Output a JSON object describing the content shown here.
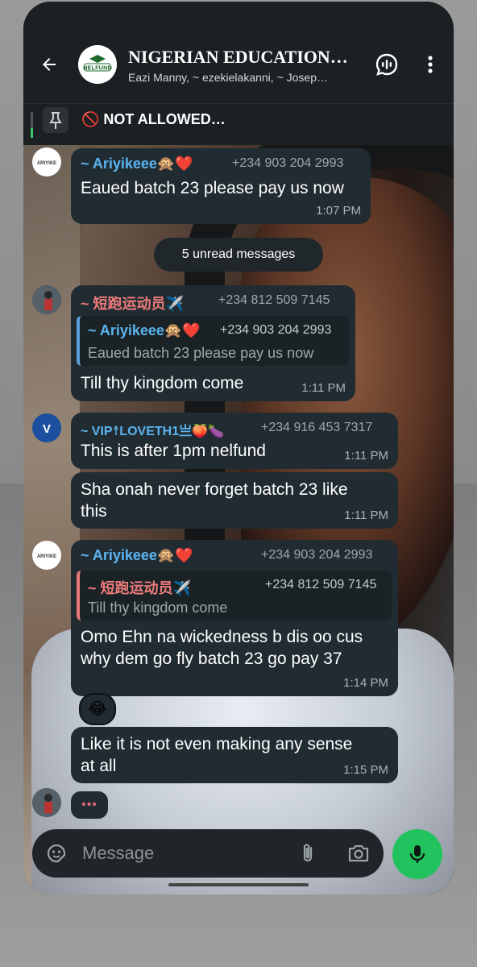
{
  "header": {
    "title": "NIGERIAN EDUCATION…",
    "subtitle": "Eazi Manny, ~ ezekielakanni, ~ Josep…",
    "group_logo_text": "NELFUND"
  },
  "pinned": {
    "text": "🚫 NOT ALLOWED…"
  },
  "unread_banner": "5 unread messages",
  "messages": [
    {
      "sender": "~ Ariyikeee🙊❤️",
      "phone": "+234 903 204 2993",
      "text": "Eaued batch 23 please pay us now",
      "time": "1:07 PM",
      "sender_color": "#5ab4f0"
    },
    {
      "sender": "~ 短跑运动员✈️",
      "phone": "+234 812 509 7145",
      "quote_sender": "~ Ariyikeee🙊❤️",
      "quote_phone": "+234 903 204 2993",
      "quote_text": "Eaued batch 23 please pay us now",
      "text": "Till thy kingdom come",
      "time": "1:11 PM",
      "sender_color": "#ec7a7a"
    },
    {
      "sender": "~ VIP☨LOVETH1亗🍑🍆",
      "phone": "+234 916 453 7317",
      "text": "This is after 1pm nelfund",
      "time": "1:11 PM",
      "sender_color": "#5ab4f0",
      "avatar_letter": "V"
    },
    {
      "text_line1": "Sha onah never forget batch 23 like",
      "text_line2": "this",
      "time": "1:11 PM"
    },
    {
      "sender": "~ Ariyikeee🙊❤️",
      "phone": "+234 903 204 2993",
      "quote_sender": "~ 短跑运动员✈️",
      "quote_phone": "+234 812 509 7145",
      "quote_text": "Till thy kingdom come",
      "text_line1": "Omo Ehn na wickedness b dis oo cus",
      "text_line2": "why dem go fly batch 23 go pay 37",
      "time": "1:14 PM",
      "sender_color": "#5ab4f0",
      "reaction": "😂"
    },
    {
      "text_line1": "Like it is not even making any sense",
      "text_line2": "at all",
      "time": "1:15 PM"
    }
  ],
  "typing_indicator": "•••",
  "composer": {
    "placeholder": "Message"
  },
  "colors": {
    "accent_green": "#22c35e",
    "bubble_bg": "#212c32",
    "header_bg": "#1b2023"
  }
}
